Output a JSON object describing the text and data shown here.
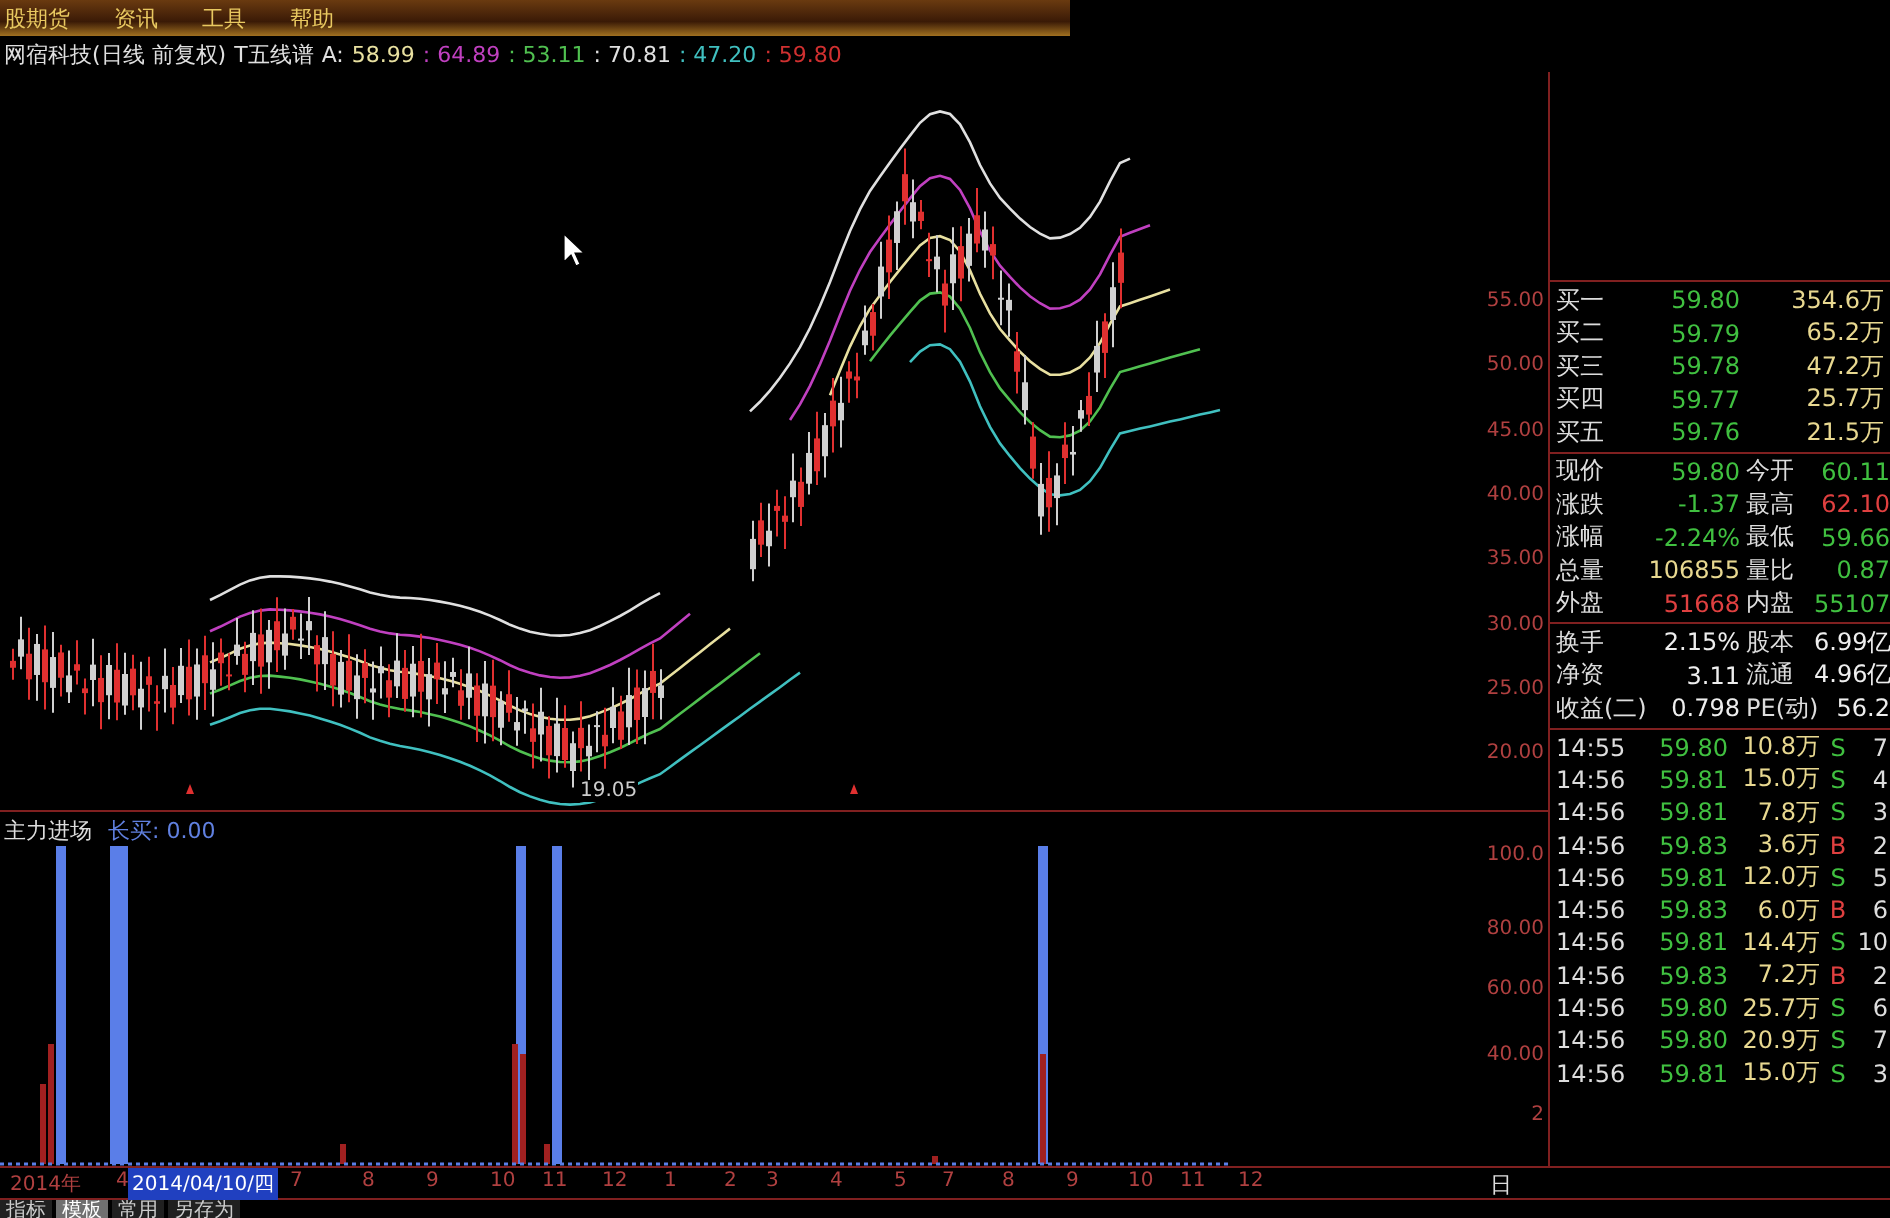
{
  "menu": [
    "股期货",
    "资讯",
    "工具",
    "帮助"
  ],
  "info": {
    "title": "网宿科技(日线 前复权)",
    "indicator": "T五线谱",
    "prefix": "A:",
    "values": [
      {
        "text": "58.99",
        "color": "#e8e0a0"
      },
      {
        "text": ": 64.89",
        "color": "#c040c0"
      },
      {
        "text": ": 53.11",
        "color": "#50c050"
      },
      {
        "text": ": 70.81",
        "color": "#e0e0e0"
      },
      {
        "text": ": 47.20",
        "color": "#40c0c0"
      },
      {
        "text": ": 59.80",
        "color": "#d03030"
      }
    ]
  },
  "price_axis": [
    "55.00",
    "50.00",
    "45.00",
    "40.00",
    "35.00",
    "30.00",
    "25.00",
    "20.00"
  ],
  "low_price_label": "19.05",
  "indicator_panel": {
    "title": "主力进场",
    "reading": "长买: 0.00",
    "axis": [
      "100.0",
      "80.00",
      "60.00",
      "40.00",
      "2"
    ]
  },
  "date_axis": {
    "year": "2014年",
    "labels": [
      "4",
      "7",
      "8",
      "9",
      "10",
      "11",
      "12",
      "1",
      "2",
      "3",
      "4",
      "5",
      "7",
      "8",
      "9",
      "10",
      "11",
      "12"
    ],
    "cursor_date": "2014/04/10/四",
    "period": "日"
  },
  "bottom_tabs": [
    {
      "label": "指标",
      "selected": false
    },
    {
      "label": "模板",
      "selected": true
    },
    {
      "label": "常用",
      "selected": false
    },
    {
      "label": "另存为",
      "selected": false
    }
  ],
  "quote": {
    "bids": [
      {
        "label": "买一",
        "price": "59.80",
        "volume": "354.6万"
      },
      {
        "label": "买二",
        "price": "59.79",
        "volume": "65.2万"
      },
      {
        "label": "买三",
        "price": "59.78",
        "volume": "47.2万"
      },
      {
        "label": "买四",
        "price": "59.77",
        "volume": "25.7万"
      },
      {
        "label": "买五",
        "price": "59.76",
        "volume": "21.5万"
      }
    ],
    "stats": [
      {
        "label": "现价",
        "value": "59.80",
        "color": "#40c040"
      },
      {
        "label": "今开",
        "value": "60.11",
        "color": "#40c040"
      },
      {
        "label": "涨跌",
        "value": "-1.37",
        "color": "#40c040"
      },
      {
        "label": "最高",
        "value": "62.10",
        "color": "#e04040"
      },
      {
        "label": "涨幅",
        "value": "-2.24%",
        "color": "#40c040"
      },
      {
        "label": "最低",
        "value": "59.66",
        "color": "#40c040"
      },
      {
        "label": "总量",
        "value": "106855",
        "color": "#e8d890"
      },
      {
        "label": "量比",
        "value": "0.87",
        "color": "#40c040"
      },
      {
        "label": "外盘",
        "value": "51668",
        "color": "#e04040"
      },
      {
        "label": "内盘",
        "value": "55107",
        "color": "#40c040"
      }
    ],
    "finance": [
      {
        "label": "换手",
        "value": "2.15%",
        "label2": "股本",
        "value2": "6.99亿"
      },
      {
        "label": "净资",
        "value": "3.11",
        "label2": "流通",
        "value2": "4.96亿"
      },
      {
        "label": "收益(二)",
        "value": "0.798",
        "label2": "PE(动)",
        "value2": "56.2"
      }
    ]
  },
  "trades": [
    {
      "time": "14:55",
      "price": "59.80",
      "volume": "10.8万",
      "side": "S",
      "kind": "sell",
      "count": "7"
    },
    {
      "time": "14:56",
      "price": "59.81",
      "volume": "15.0万",
      "side": "S",
      "kind": "sell",
      "count": "4"
    },
    {
      "time": "14:56",
      "price": "59.81",
      "volume": "7.8万",
      "side": "S",
      "kind": "sell",
      "count": "3"
    },
    {
      "time": "14:56",
      "price": "59.83",
      "volume": "3.6万",
      "side": "B",
      "kind": "buy",
      "count": "2"
    },
    {
      "time": "14:56",
      "price": "59.81",
      "volume": "12.0万",
      "side": "S",
      "kind": "sell",
      "count": "5"
    },
    {
      "time": "14:56",
      "price": "59.83",
      "volume": "6.0万",
      "side": "B",
      "kind": "buy",
      "count": "6"
    },
    {
      "time": "14:56",
      "price": "59.81",
      "volume": "14.4万",
      "side": "S",
      "kind": "sell",
      "count": "10"
    },
    {
      "time": "14:56",
      "price": "59.83",
      "volume": "7.2万",
      "side": "B",
      "kind": "buy",
      "count": "2"
    },
    {
      "time": "14:56",
      "price": "59.80",
      "volume": "25.7万",
      "side": "S",
      "kind": "sell",
      "count": "6"
    },
    {
      "time": "14:56",
      "price": "59.80",
      "volume": "20.9万",
      "side": "S",
      "kind": "sell",
      "count": "7"
    },
    {
      "time": "14:56",
      "price": "59.81",
      "volume": "15.0万",
      "side": "S",
      "kind": "sell",
      "count": "3"
    }
  ]
}
